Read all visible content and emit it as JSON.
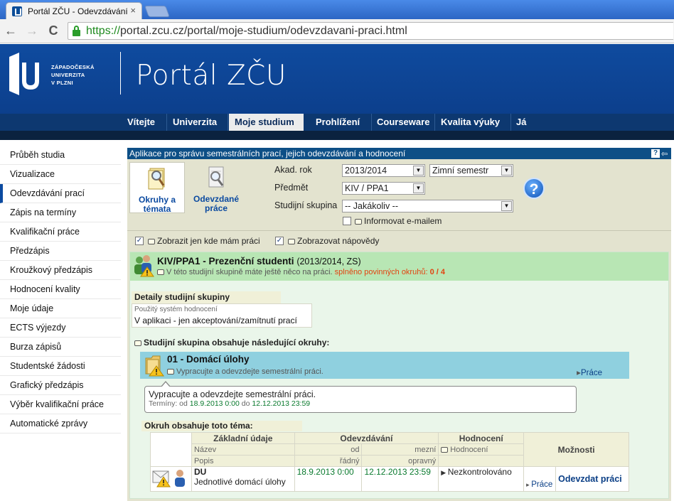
{
  "browser": {
    "tab_title": "Portál ZČU - Odevzdávání",
    "tab_close": "×",
    "url_scheme": "https://",
    "url_rest": "portal.zcu.cz/portal/moje-studium/odevzdavani-praci.html",
    "back": "←",
    "forward": "→",
    "reload": "C"
  },
  "header": {
    "logo_line1": "ZÁPADOČESKÁ",
    "logo_line2": "UNIVERZITA",
    "logo_line3": "V PLZNI",
    "title": "Portál ZČU"
  },
  "topnav": [
    "Vítejte",
    "Univerzita",
    "Moje studium",
    "Prohlížení",
    "Courseware",
    "Kvalita výuky",
    "Já"
  ],
  "sidebar": [
    "Průběh studia",
    "Vizualizace",
    "Odevzdávání prací",
    "Zápis na termíny",
    "Kvalifikační práce",
    "Předzápis",
    "Kroužkový předzápis",
    "Hodnocení kvality",
    "Moje údaje",
    "ECTS výjezdy",
    "Burza zápisů",
    "Studentské žádosti",
    "Grafický předzápis",
    "Výběr kvalifikační práce",
    "Automatické zprávy"
  ],
  "app": {
    "title": "Aplikace pro správu semestrálních prací, jejich odevzdávání a hodnocení",
    "help_small": "?",
    "back_small": "⇦",
    "tile1_line1": "Okruhy a",
    "tile1_line2": "témata",
    "tile2_line1": "Odevzdané",
    "tile2_line2": "práce",
    "akad_rok_label": "Akad. rok",
    "akad_rok_value": "2013/2014",
    "semestr_value": "Zimní semestr",
    "predmet_label": "Předmět",
    "predmet_value": "KIV / PPA1",
    "skupina_label": "Studijní skupina",
    "skupina_value": "-- Jakákoliv --",
    "informovat": "Informovat e-mailem",
    "help_big": "?",
    "chk1": "Zobrazit jen kde mám práci",
    "chk2": "Zobrazovat nápovědy",
    "check_mark": "✓"
  },
  "group": {
    "title": "KIV/PPA1 - Prezenční studenti",
    "year": "(2013/2014, ZS)",
    "sub_text": "V této studijní skupině máte ještě něco na práci.",
    "sub_red": "splněno povinných okruhů:",
    "sub_count": "0 / 4"
  },
  "details": {
    "head": "Detaily studijní skupiny",
    "label": "Použitý systém hodnocení",
    "value": "V aplikaci - jen akceptování/zamítnutí prací"
  },
  "okruhy_head": "Studijní skupina obsahuje následující okruhy:",
  "topic": {
    "title": "01 - Domácí úlohy",
    "sub": "Vypracujte a odevzdejte semestrální práci.",
    "link": "Práce"
  },
  "tip": {
    "line1": "Vypracujte a odevzdejte semestrální práci.",
    "terminy": "Termíny: od",
    "od": "18.9.2013 0:00",
    "do_label": "do",
    "do": "12.12.2013 23:59"
  },
  "okruh_obsah": "Okruh obsahuje toto téma:",
  "table": {
    "h_zakladni": "Základní údaje",
    "h_odevzdavani": "Odevzdávání",
    "h_hodnoceni": "Hodnocení",
    "h_moznosti": "Možnosti",
    "nazev": "Název",
    "od": "od",
    "mezni": "mezní",
    "hodnoceni": "Hodnocení",
    "popis": "Popis",
    "radny": "řádný",
    "opravny": "opravný",
    "row": {
      "code": "DU",
      "desc": "Jednotlivé domácí úlohy",
      "od": "18.9.2013 0:00",
      "mezni": "12.12.2013 23:59",
      "stav": "Nezkontrolováno",
      "prace": "Práce",
      "odevzdat": "Odevzdat práci"
    }
  }
}
